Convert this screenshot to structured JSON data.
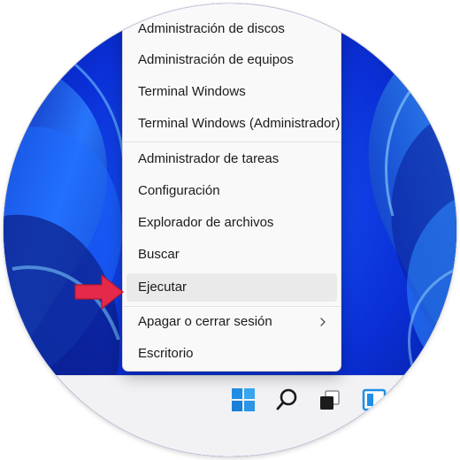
{
  "menu": {
    "items": [
      {
        "label": "Administración de discos"
      },
      {
        "label": "Administración de equipos"
      },
      {
        "label": "Terminal Windows"
      },
      {
        "label": "Terminal Windows (Administrador)"
      },
      {
        "label": "Administrador de tareas"
      },
      {
        "label": "Configuración"
      },
      {
        "label": "Explorador de archivos"
      },
      {
        "label": "Buscar"
      },
      {
        "label": "Ejecutar",
        "highlighted": true
      },
      {
        "label": "Apagar o cerrar sesión",
        "submenu": true
      },
      {
        "label": "Escritorio"
      }
    ]
  },
  "taskbar": {
    "icons": [
      "windows-start-icon",
      "search-icon",
      "task-view-icon",
      "widgets-icon"
    ]
  },
  "colors": {
    "wallpaper": "#0a2bd8",
    "menu_bg": "#f9f9f9",
    "hover": "#eaeaea",
    "arrow": "#e5294a",
    "start_blue": "#2b8fe0"
  }
}
